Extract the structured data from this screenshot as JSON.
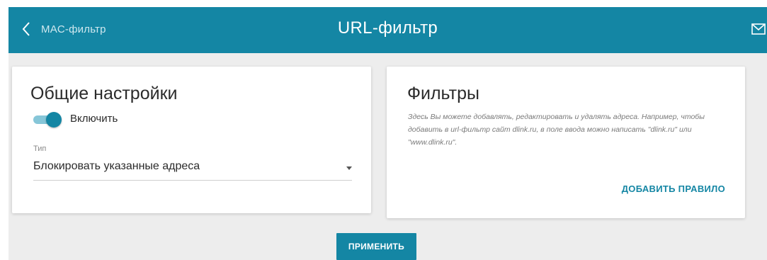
{
  "header": {
    "back_label": "MAC-фильтр",
    "title": "URL-фильтр"
  },
  "general": {
    "title": "Общие настройки",
    "enable_label": "Включить",
    "enabled": true,
    "type_label": "Тип",
    "type_value": "Блокировать указанные адреса"
  },
  "filters": {
    "title": "Фильтры",
    "description": "Здесь Вы можете добавлять, редактировать и удалять адреса. Например, чтобы добавить в url-фильтр сайт dlink.ru, в поле ввода можно написать \"dlink.ru\" или \"www.dlink.ru\".",
    "add_rule_label": "ДОБАВИТЬ ПРАВИЛО"
  },
  "actions": {
    "apply_label": "ПРИМЕНИТЬ"
  },
  "icons": {
    "back": "chevron-left-icon",
    "notifications": "mail-icon",
    "dropdown": "caret-down-icon"
  },
  "colors": {
    "accent": "#1486a4",
    "background": "#ededed"
  }
}
